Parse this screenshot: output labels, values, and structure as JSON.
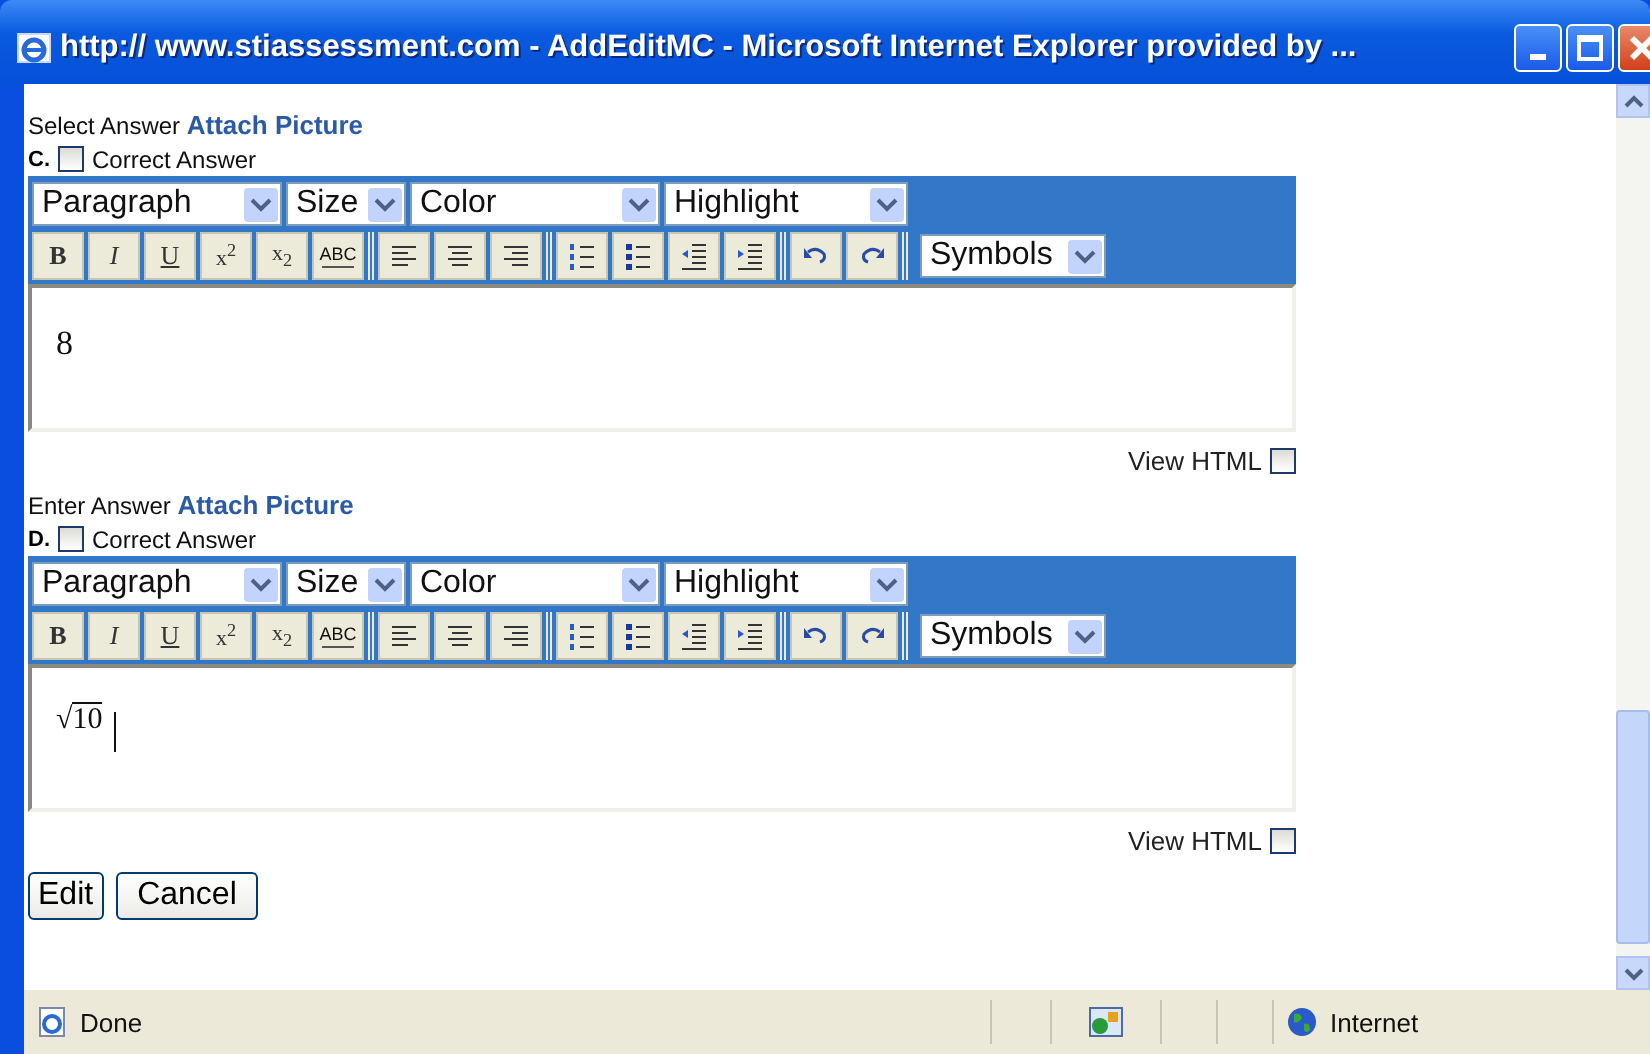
{
  "window": {
    "title": "http:// www.stiassessment.com - AddEditMC - Microsoft Internet Explorer provided by ..."
  },
  "answers": [
    {
      "prompt": "Select Answer",
      "link": "Attach Picture",
      "letter": "C.",
      "correct_label": "Correct Answer",
      "correct": false,
      "selects": [
        {
          "label": "Paragraph"
        },
        {
          "label": "Size"
        },
        {
          "label": "Color"
        },
        {
          "label": "Highlight"
        }
      ],
      "buttons": [
        {
          "kind": "bold",
          "label": "B"
        },
        {
          "kind": "italic",
          "label": "I"
        },
        {
          "kind": "underline",
          "label": "U"
        },
        {
          "kind": "sup",
          "label": "x$^{2}$"
        },
        {
          "kind": "sub",
          "label": "x$_{2}$"
        },
        {
          "kind": "strike",
          "label": "ABC"
        },
        {
          "kind": "separator"
        },
        {
          "kind": "align-left"
        },
        {
          "kind": "align-center"
        },
        {
          "kind": "align-right"
        },
        {
          "kind": "separator"
        },
        {
          "kind": "ordered-list"
        },
        {
          "kind": "bullet-list"
        },
        {
          "kind": "outdent"
        },
        {
          "kind": "indent"
        },
        {
          "kind": "separator"
        },
        {
          "kind": "undo"
        },
        {
          "kind": "redo"
        },
        {
          "kind": "separator"
        }
      ],
      "symbols": "Symbols",
      "content": {
        "kind": "text",
        "value": "8"
      },
      "cursor": false,
      "view_html_label": "View HTML",
      "view_html": false
    },
    {
      "prompt": "Enter Answer",
      "link": "Attach Picture",
      "letter": "D.",
      "correct_label": "Correct Answer",
      "correct": false,
      "selects": [
        {
          "label": "Paragraph"
        },
        {
          "label": "Size"
        },
        {
          "label": "Color"
        },
        {
          "label": "Highlight"
        }
      ],
      "buttons": [
        {
          "kind": "bold",
          "label": "B"
        },
        {
          "kind": "italic",
          "label": "I"
        },
        {
          "kind": "underline",
          "label": "U"
        },
        {
          "kind": "sup",
          "label": "x$^{2}$"
        },
        {
          "kind": "sub",
          "label": "x$_{2}$"
        },
        {
          "kind": "strike",
          "label": "ABC"
        },
        {
          "kind": "separator"
        },
        {
          "kind": "align-left"
        },
        {
          "kind": "align-center"
        },
        {
          "kind": "align-right"
        },
        {
          "kind": "separator"
        },
        {
          "kind": "ordered-list"
        },
        {
          "kind": "bullet-list"
        },
        {
          "kind": "outdent"
        },
        {
          "kind": "indent"
        },
        {
          "kind": "separator"
        },
        {
          "kind": "undo"
        },
        {
          "kind": "redo"
        },
        {
          "kind": "separator"
        }
      ],
      "symbols": "Symbols",
      "content": {
        "kind": "sqrt",
        "radical": "√",
        "value": "10"
      },
      "cursor": true,
      "view_html_label": "View HTML",
      "view_html": false
    }
  ],
  "buttons": [
    "Edit",
    "Cancel"
  ],
  "status_bar": {
    "status": "Done",
    "zone": "Internet"
  }
}
